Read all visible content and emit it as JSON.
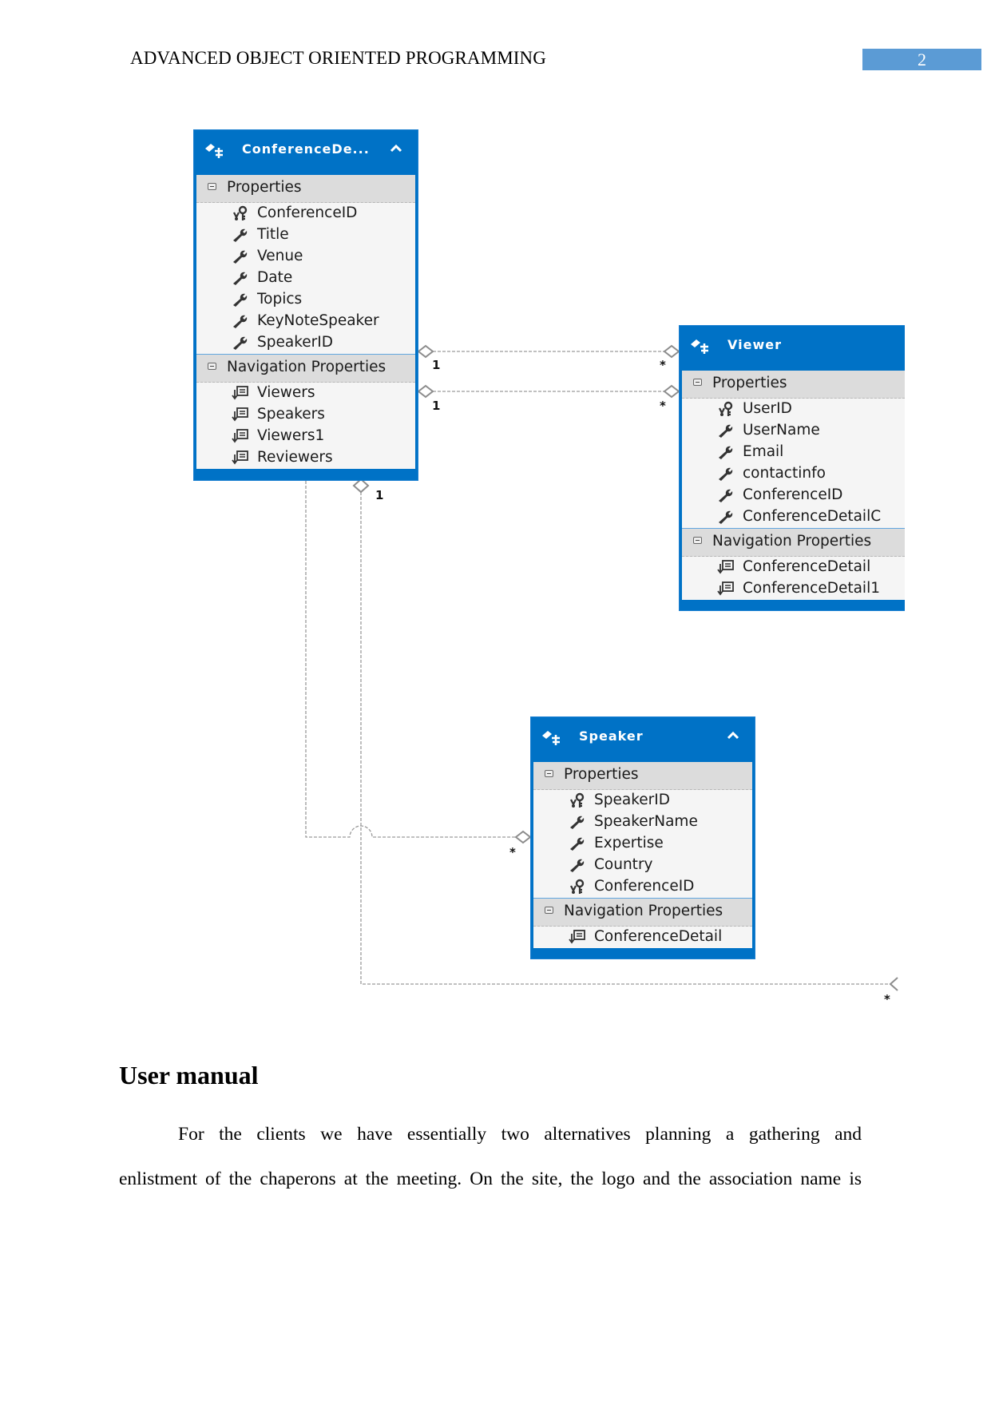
{
  "header": {
    "running_title": "ADVANCED OBJECT ORIENTED PROGRAMMING",
    "page_number": "2"
  },
  "diagram": {
    "entities": [
      {
        "id": "conference-detail",
        "title": "ConferenceDe...",
        "collapsible": true,
        "sections": [
          {
            "label": "Properties",
            "items": [
              {
                "name": "ConferenceID",
                "icon": "key-icon"
              },
              {
                "name": "Title",
                "icon": "wrench-icon"
              },
              {
                "name": "Venue",
                "icon": "wrench-icon"
              },
              {
                "name": "Date",
                "icon": "wrench-icon"
              },
              {
                "name": "Topics",
                "icon": "wrench-icon"
              },
              {
                "name": "KeyNoteSpeaker",
                "icon": "wrench-icon"
              },
              {
                "name": "SpeakerID",
                "icon": "wrench-icon"
              }
            ]
          },
          {
            "label": "Navigation Properties",
            "items": [
              {
                "name": "Viewers",
                "icon": "navigation-property-icon"
              },
              {
                "name": "Speakers",
                "icon": "navigation-property-icon"
              },
              {
                "name": "Viewers1",
                "icon": "navigation-property-icon"
              },
              {
                "name": "Reviewers",
                "icon": "navigation-property-icon"
              }
            ]
          }
        ]
      },
      {
        "id": "viewer",
        "title": "Viewer",
        "collapsible": false,
        "sections": [
          {
            "label": "Properties",
            "items": [
              {
                "name": "UserID",
                "icon": "key-icon"
              },
              {
                "name": "UserName",
                "icon": "wrench-icon"
              },
              {
                "name": "Email",
                "icon": "wrench-icon"
              },
              {
                "name": "contactinfo",
                "icon": "wrench-icon"
              },
              {
                "name": "ConferenceID",
                "icon": "wrench-icon"
              },
              {
                "name": "ConferenceDetailC",
                "icon": "wrench-icon"
              }
            ]
          },
          {
            "label": "Navigation Properties",
            "items": [
              {
                "name": "ConferenceDetail",
                "icon": "navigation-property-icon"
              },
              {
                "name": "ConferenceDetail1",
                "icon": "navigation-property-icon"
              }
            ]
          }
        ]
      },
      {
        "id": "speaker",
        "title": "Speaker",
        "collapsible": true,
        "sections": [
          {
            "label": "Properties",
            "items": [
              {
                "name": "SpeakerID",
                "icon": "key-icon"
              },
              {
                "name": "SpeakerName",
                "icon": "wrench-icon"
              },
              {
                "name": "Expertise",
                "icon": "wrench-icon"
              },
              {
                "name": "Country",
                "icon": "wrench-icon"
              },
              {
                "name": "ConferenceID",
                "icon": "key-icon"
              }
            ]
          },
          {
            "label": "Navigation Properties",
            "items": [
              {
                "name": "ConferenceDetail",
                "icon": "navigation-property-icon"
              }
            ]
          }
        ]
      }
    ],
    "associations": [
      {
        "from": "ConferenceDetail",
        "to": "Viewer",
        "from_multiplicity": "1",
        "to_multiplicity": "*"
      },
      {
        "from": "ConferenceDetail",
        "to": "Viewer",
        "from_multiplicity": "1",
        "to_multiplicity": "*"
      },
      {
        "from": "ConferenceDetail",
        "to": "Speaker",
        "from_multiplicity": "1",
        "to_multiplicity": "*"
      },
      {
        "from": "ConferenceDetail",
        "to": "(off-page)",
        "from_multiplicity": "1",
        "to_multiplicity": "*"
      }
    ],
    "colors": {
      "entity_header": "#0072c6",
      "section_band": "#dcdcdc",
      "body": "#f5f5f5",
      "connector": "#999999",
      "page_number_bg": "#5b9bd5"
    }
  },
  "content": {
    "heading": "User manual",
    "paragraph_line1": "For the clients we have essentially two alternatives planning a gathering and",
    "paragraph_line2": "enlistment of the chaperons at the meeting. On the site, the logo and the association name is"
  }
}
